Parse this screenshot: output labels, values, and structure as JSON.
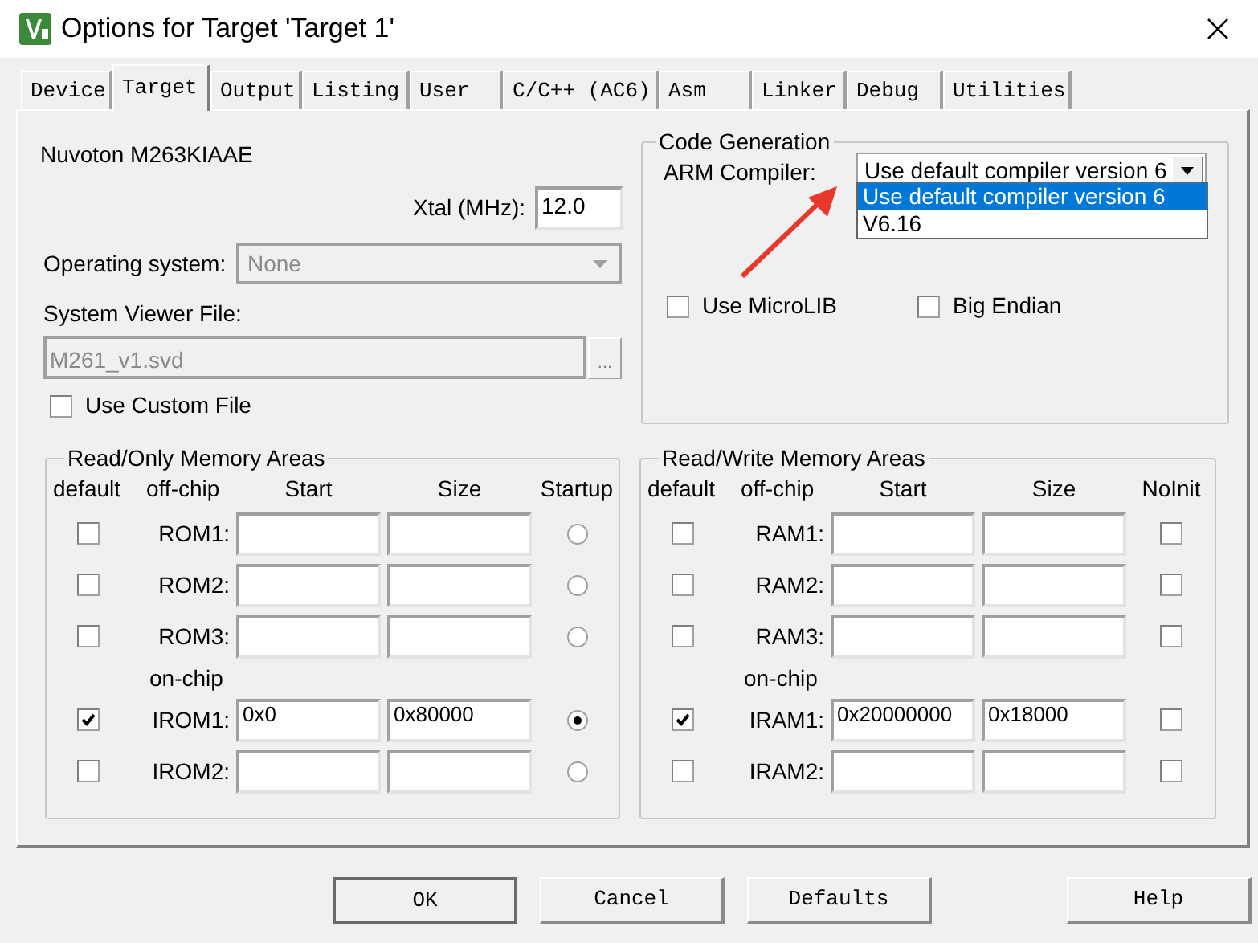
{
  "window": {
    "title": "Options for Target 'Target 1'"
  },
  "tabs": [
    {
      "label": "Device",
      "selected": false
    },
    {
      "label": "Target",
      "selected": true
    },
    {
      "label": "Output",
      "selected": false
    },
    {
      "label": "Listing",
      "selected": false
    },
    {
      "label": "User",
      "selected": false
    },
    {
      "label": "C/C++ (AC6)",
      "selected": false
    },
    {
      "label": "Asm",
      "selected": false
    },
    {
      "label": "Linker",
      "selected": false
    },
    {
      "label": "Debug",
      "selected": false
    },
    {
      "label": "Utilities",
      "selected": false
    }
  ],
  "device": "Nuvoton M263KIAAE",
  "xtal": {
    "label": "Xtal (MHz):",
    "value": "12.0"
  },
  "operating_system": {
    "label": "Operating system:",
    "value": "None",
    "disabled": true
  },
  "system_viewer": {
    "label": "System Viewer File:",
    "value": "M261_v1.svd",
    "disabled": true,
    "browse": "..."
  },
  "use_custom_file": {
    "label": "Use Custom File",
    "checked": false
  },
  "code_generation": {
    "title": "Code Generation",
    "compiler_label": "ARM Compiler:",
    "compiler_value": "Use default compiler version 6",
    "dropdown_items": [
      {
        "label": "Use default compiler version 6",
        "selected": true
      },
      {
        "label": "V6.16",
        "selected": false
      }
    ],
    "use_microlib": {
      "label": "Use MicroLIB",
      "checked": false
    },
    "big_endian": {
      "label": "Big Endian",
      "checked": false
    }
  },
  "read_only_memory": {
    "title": "Read/Only Memory Areas",
    "columns": [
      "default",
      "off-chip",
      "Start",
      "Size",
      "Startup"
    ],
    "rows": [
      {
        "kind": "memory",
        "label": "ROM1:",
        "default": false,
        "start": "",
        "size": "",
        "flag": false
      },
      {
        "kind": "memory",
        "label": "ROM2:",
        "default": false,
        "start": "",
        "size": "",
        "flag": false
      },
      {
        "kind": "memory",
        "label": "ROM3:",
        "default": false,
        "start": "",
        "size": "",
        "flag": false
      },
      {
        "kind": "section",
        "label": "on-chip"
      },
      {
        "kind": "memory",
        "label": "IROM1:",
        "default": true,
        "start": "0x0",
        "size": "0x80000",
        "flag": true
      },
      {
        "kind": "memory",
        "label": "IROM2:",
        "default": false,
        "start": "",
        "size": "",
        "flag": false
      }
    ]
  },
  "read_write_memory": {
    "title": "Read/Write Memory Areas",
    "columns": [
      "default",
      "off-chip",
      "Start",
      "Size",
      "NoInit"
    ],
    "rows": [
      {
        "kind": "memory",
        "label": "RAM1:",
        "default": false,
        "start": "",
        "size": "",
        "flag": false
      },
      {
        "kind": "memory",
        "label": "RAM2:",
        "default": false,
        "start": "",
        "size": "",
        "flag": false
      },
      {
        "kind": "memory",
        "label": "RAM3:",
        "default": false,
        "start": "",
        "size": "",
        "flag": false
      },
      {
        "kind": "section",
        "label": "on-chip"
      },
      {
        "kind": "memory",
        "label": "IRAM1:",
        "default": true,
        "start": "0x20000000",
        "size": "0x18000",
        "flag": false
      },
      {
        "kind": "memory",
        "label": "IRAM2:",
        "default": false,
        "start": "",
        "size": "",
        "flag": false
      }
    ]
  },
  "buttons": [
    {
      "label": "OK",
      "kind": "default"
    },
    {
      "label": "Cancel",
      "kind": "normal"
    },
    {
      "label": "Defaults",
      "kind": "normal"
    },
    {
      "label": "Help",
      "kind": "normal"
    }
  ]
}
